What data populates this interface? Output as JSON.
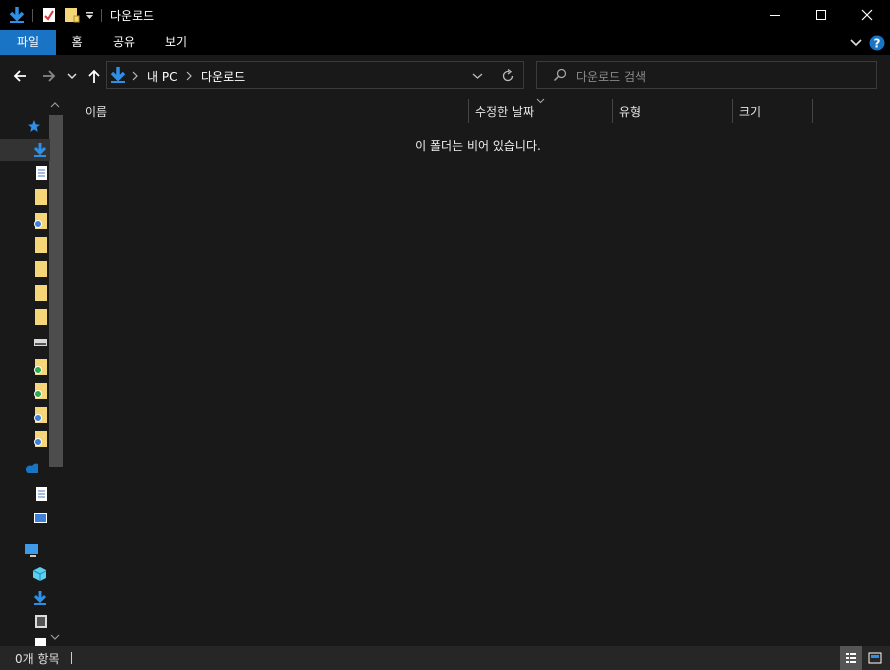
{
  "window": {
    "title": "다운로드"
  },
  "ribbon": {
    "tabs": [
      "파일",
      "홈",
      "공유",
      "보기"
    ]
  },
  "address": {
    "crumbs": [
      "내 PC",
      "다운로드"
    ]
  },
  "search": {
    "placeholder": "다운로드 검색"
  },
  "columns": [
    "이름",
    "수정한 날짜",
    "유형",
    "크기"
  ],
  "main": {
    "empty_message": "이 폴더는 비어 있습니다."
  },
  "status": {
    "item_count": "0개 항목"
  },
  "colors": {
    "accent": "#1a74c6",
    "background": "#191919",
    "titlebar": "#000000"
  },
  "icons": [
    "down-arrow-icon",
    "properties-icon",
    "folder-icon",
    "customize-chevron-icon",
    "minimize-icon",
    "maximize-icon",
    "close-icon",
    "help-icon",
    "back-icon",
    "forward-icon",
    "up-icon",
    "refresh-icon",
    "search-icon",
    "quick-access-star-icon",
    "onedrive-icon",
    "this-pc-icon"
  ]
}
